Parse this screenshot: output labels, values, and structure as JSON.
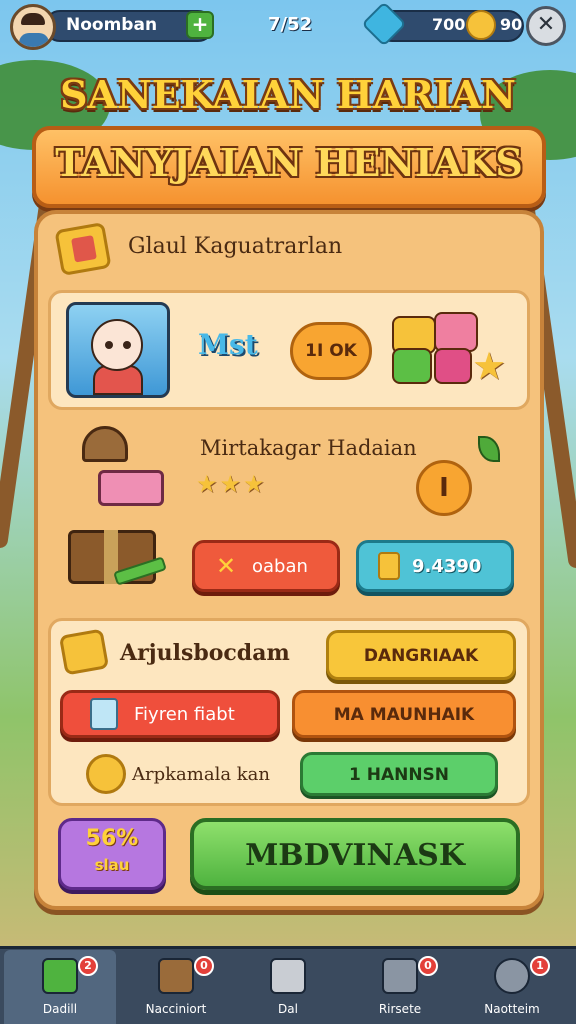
{
  "header": {
    "player_name": "Noomban",
    "add_label": "+",
    "level": "7/52",
    "gems": "700",
    "coins": "90",
    "close_label": "✕"
  },
  "titles": {
    "main": "SANEKAIAN HARIAN",
    "banner": "TANYJAIAN HENIAKS"
  },
  "section": {
    "title": "Glaul Kaguatrarlan"
  },
  "card1": {
    "mist_label": "Mst",
    "ok_label": "1I OK"
  },
  "reward": {
    "title": "Mirtakagar Hadaian",
    "stars": "★★★",
    "badge": "I",
    "claim_icon": "✕",
    "claim_label": "oaban",
    "price_label": "9.4390"
  },
  "card2": {
    "title": "Arjulsbocdam",
    "yellow_button": "DANGRIAAK",
    "red_button": "Fiyren fiabt",
    "orange_button": "MA MAUNHAIK",
    "coin_text": "Arpkamala kan",
    "green_button": "1 HANNSN"
  },
  "bottom_action": {
    "discount_pct": "56%",
    "discount_sub": "slau",
    "big_button": "MBDVINASK"
  },
  "nav": [
    {
      "label": "Dadill",
      "badge": "2",
      "color": "#4fb33f"
    },
    {
      "label": "Nacciniort",
      "badge": "0",
      "color": "#9a6b3a"
    },
    {
      "label": "Dal",
      "badge": "",
      "color": "#c9cdd3"
    },
    {
      "label": "Rirsete",
      "badge": "0",
      "color": "#8a95a3"
    },
    {
      "label": "Naotteim",
      "badge": "1",
      "color": "#8a95a3"
    }
  ],
  "colors": {
    "panel": "#f5c27c",
    "primary_green": "#4fb33f",
    "accent_orange": "#f88f31",
    "nav_bg": "#3a4a5e"
  }
}
